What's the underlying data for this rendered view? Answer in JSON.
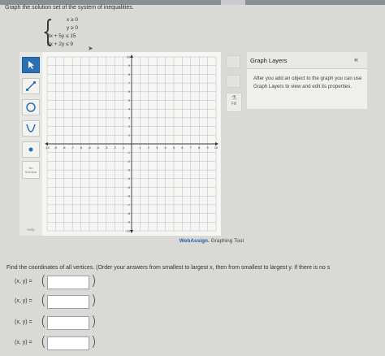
{
  "prompt": "Graph the solution set of the system of inequalities.",
  "system": {
    "inequalities": [
      "x ≥ 0",
      "y ≥ 0",
      "3x + 5y ≤ 15",
      "3x + 2y ≤ 9"
    ]
  },
  "toolbar": {
    "no_solution_label": "No Solution",
    "help_label": "Help"
  },
  "graph": {
    "x_range": [
      -10,
      10
    ],
    "y_range": [
      -10,
      10
    ],
    "x_ticks": [
      "-10",
      "-9",
      "-8",
      "-7",
      "-6",
      "-5",
      "-4",
      "-3",
      "-2",
      "-1",
      "1",
      "2",
      "3",
      "4",
      "5",
      "6",
      "7",
      "8",
      "9",
      "10"
    ],
    "y_ticks": [
      "10",
      "9",
      "8",
      "7",
      "6",
      "5",
      "4",
      "3",
      "2",
      "1",
      "-1",
      "-2",
      "-3",
      "-4",
      "-5",
      "-6",
      "-7",
      "-8",
      "-9",
      "-10"
    ],
    "grid": true
  },
  "fill_label": "Fill",
  "layers": {
    "title": "Graph Layers",
    "collapse_icon": "«",
    "message": "After you add an object to the graph you can use Graph Layers to view and edit its properties."
  },
  "brand": {
    "name": "WebAssign.",
    "suffix": "Graphing Tool"
  },
  "question": "Find the coordinates of all vertices. (Order your answers from smallest to largest x, then from smallest to largest y. If there is no s",
  "answers": [
    {
      "label": "(x, y) =",
      "value": ""
    },
    {
      "label": "(x, y) =",
      "value": ""
    },
    {
      "label": "(x, y) =",
      "value": ""
    },
    {
      "label": "(x, y) =",
      "value": ""
    }
  ]
}
